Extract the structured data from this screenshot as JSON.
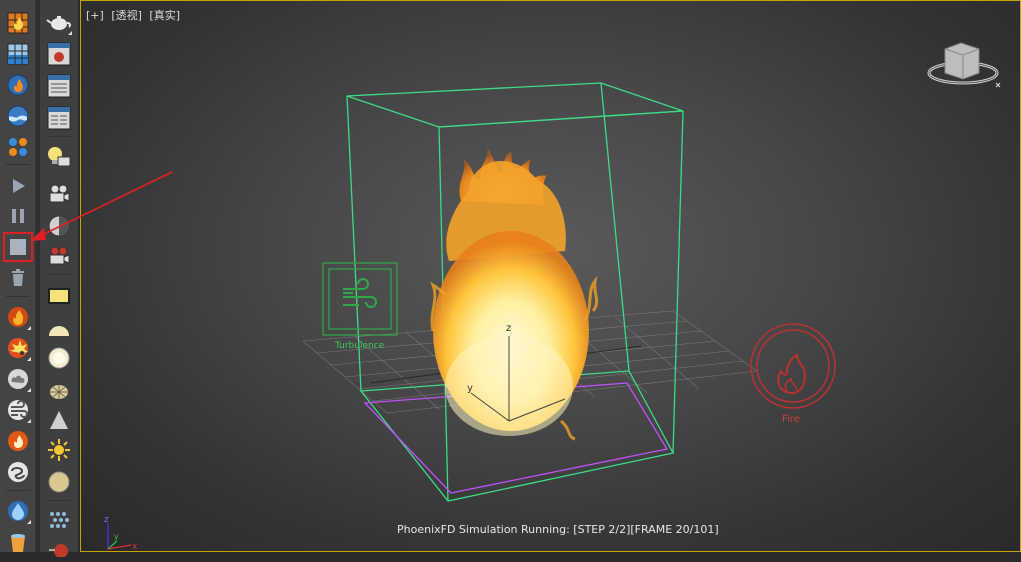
{
  "viewport": {
    "label_plus": "[+]",
    "label_view": "[透视]",
    "label_shading": "[真实]",
    "status": "PhoenixFD Simulation Running: [STEP 2/2][FRAME 20/101]",
    "gizmo_labels": {
      "turbulence": "Turbulence",
      "fire": "Fire"
    },
    "axis_labels": {
      "x": "x",
      "y": "y",
      "z": "z"
    }
  },
  "colors": {
    "accent_border": "#c8a400",
    "highlight_red": "#e02020",
    "grid_box": "#3ddc84",
    "turbulence_gizmo": "#2fa84a",
    "fire_gizmo": "#b83232",
    "selection_magenta": "#c050ff"
  },
  "left_toolbar": {
    "items": [
      {
        "name": "fire-grid-icon"
      },
      {
        "name": "liquid-grid-icon"
      },
      {
        "name": "fire-source-icon"
      },
      {
        "name": "liquid-source-icon"
      },
      {
        "name": "particle-dots-icon"
      },
      {
        "name": "play-icon"
      },
      {
        "name": "pause-icon"
      },
      {
        "name": "stop-icon",
        "highlighted": true
      },
      {
        "name": "trash-icon"
      },
      {
        "name": "fire-preset-icon"
      },
      {
        "name": "explosion-preset-icon"
      },
      {
        "name": "smoke-preset-icon"
      },
      {
        "name": "wind-preset-icon"
      },
      {
        "name": "fire-drop-icon"
      },
      {
        "name": "swirl-icon"
      },
      {
        "name": "water-drop-icon"
      },
      {
        "name": "bucket-icon"
      }
    ]
  },
  "right_toolbar": {
    "items": [
      {
        "name": "teapot-icon"
      },
      {
        "name": "render-frame-icon"
      },
      {
        "name": "render-setup-icon"
      },
      {
        "name": "material-editor-icon"
      },
      {
        "name": "light-bulb-icon"
      },
      {
        "name": "camera-icon"
      },
      {
        "name": "camera-lens-icon"
      },
      {
        "name": "video-camera-icon"
      },
      {
        "name": "plane-light-icon"
      },
      {
        "name": "dome-light-icon"
      },
      {
        "name": "sphere-light-icon"
      },
      {
        "name": "mesh-light-icon"
      },
      {
        "name": "cone-icon"
      },
      {
        "name": "sun-icon"
      },
      {
        "name": "ambient-sphere-icon"
      },
      {
        "name": "particle-grid-icon"
      },
      {
        "name": "red-ball-icon"
      }
    ]
  }
}
